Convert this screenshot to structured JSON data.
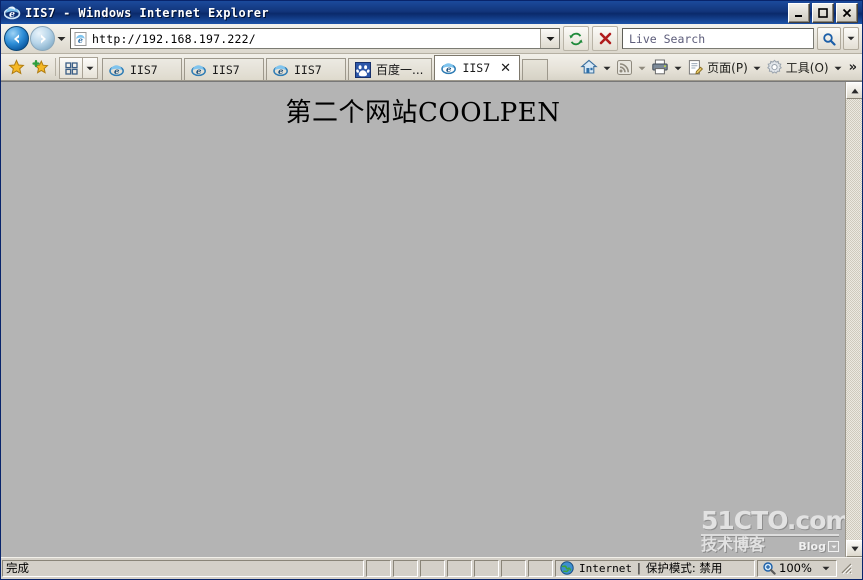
{
  "window": {
    "title": "IIS7 - Windows Internet Explorer",
    "icon": "ie-icon",
    "controls": {
      "minimize": "minimize-button",
      "maximize": "maximize-button",
      "close": "close-button"
    }
  },
  "navbar": {
    "back_label": "Back",
    "forward_label": "Forward",
    "recent_pages_label": "Recent Pages",
    "address": {
      "value": "http://192.168.197.222/",
      "placeholder": "Address"
    },
    "refresh_label": "Refresh",
    "stop_label": "Stop",
    "search": {
      "placeholder": "Live Search",
      "value": "",
      "go_label": "Search",
      "options_label": "Search Options"
    }
  },
  "favbar": {
    "favorites_center_label": "Favorites Center",
    "add_to_favorites_label": "Add to Favorites",
    "quick_tabs_label": "Quick Tabs",
    "tab_list_label": "Tab List"
  },
  "tabs": [
    {
      "label": "IIS7",
      "icon": "ie-icon",
      "active": false,
      "cjk": false
    },
    {
      "label": "IIS7",
      "icon": "ie-icon",
      "active": false,
      "cjk": false
    },
    {
      "label": "IIS7",
      "icon": "ie-icon",
      "active": false,
      "cjk": false
    },
    {
      "label": "百度一...",
      "icon": "baidu-icon",
      "active": false,
      "cjk": true
    },
    {
      "label": "IIS7",
      "icon": "ie-icon",
      "active": true,
      "cjk": false,
      "close": "✕"
    }
  ],
  "new_tab_label": "New Tab",
  "commandbar": {
    "home_label": "Home",
    "feeds_label": "Feeds",
    "print_label": "Print",
    "page_label": "页面(P)",
    "tools_label": "工具(O)",
    "overflow_label": "»"
  },
  "page": {
    "heading": "第二个网站COOLPEN",
    "background_color": "#b4b4b4",
    "watermark": {
      "line1": "51CTO.com",
      "line2": "技术博客",
      "badge": "Blog"
    }
  },
  "scrollbar": {
    "up_label": "Scroll Up",
    "down_label": "Scroll Down"
  },
  "statusbar": {
    "status": "完成",
    "zone_icon": "globe-icon",
    "zone": "Internet",
    "separator": "|",
    "protected_mode": "保护模式: 禁用",
    "zoom": "100%",
    "zoom_icon": "magnifier-plus-icon",
    "zoom_dropdown_label": "Change Zoom Level",
    "resize_grip_label": "Resize"
  },
  "colors": {
    "titlebar": "#12357b",
    "chrome": "#d4d0c8",
    "page_bg": "#b4b4b4",
    "accent": "#1b4a9c"
  }
}
